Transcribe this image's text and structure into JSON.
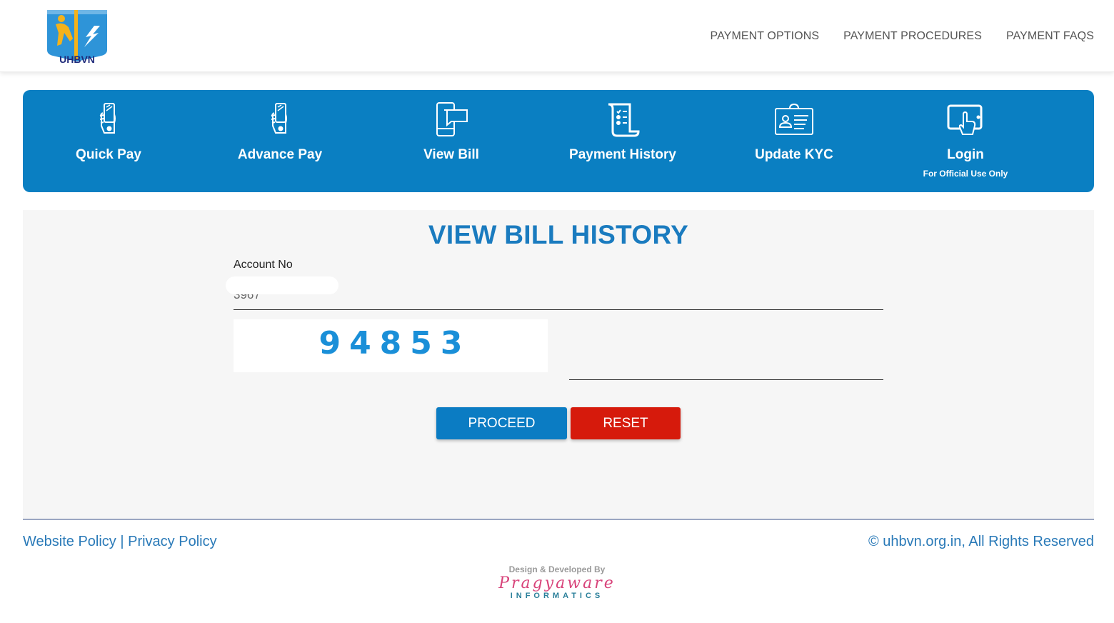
{
  "header": {
    "logo_text": "UHBVN",
    "nav": [
      {
        "label": "PAYMENT OPTIONS"
      },
      {
        "label": "PAYMENT PROCEDURES"
      },
      {
        "label": "PAYMENT FAQS"
      }
    ]
  },
  "services": [
    {
      "label": "Quick Pay",
      "icon": "hand-phone-icon"
    },
    {
      "label": "Advance Pay",
      "icon": "hand-phone-icon"
    },
    {
      "label": "View Bill",
      "icon": "phone-message-icon"
    },
    {
      "label": "Payment History",
      "icon": "scroll-checklist-icon"
    },
    {
      "label": "Update KYC",
      "icon": "id-card-icon"
    },
    {
      "label": "Login",
      "sublabel": "For Official Use Only",
      "icon": "tablet-touch-icon"
    }
  ],
  "form": {
    "title": "VIEW BILL HISTORY",
    "account_label": "Account No",
    "account_value": "3967",
    "captcha_code": "94853",
    "captcha_value": "",
    "proceed_label": "PROCEED",
    "reset_label": "RESET"
  },
  "colors": {
    "brand_blue": "#0a7fc2",
    "title_blue": "#1a7bbf",
    "reset_red": "#d61a0c"
  },
  "footer": {
    "website_policy": "Website Policy",
    "separator": " | ",
    "privacy_policy": "Privacy Policy",
    "copyright": "© uhbvn.org.in, All Rights Reserved",
    "credit_by": "Design & Developed By",
    "credit_brand": "Pragyaware",
    "credit_sub": "INFORMATICS"
  }
}
